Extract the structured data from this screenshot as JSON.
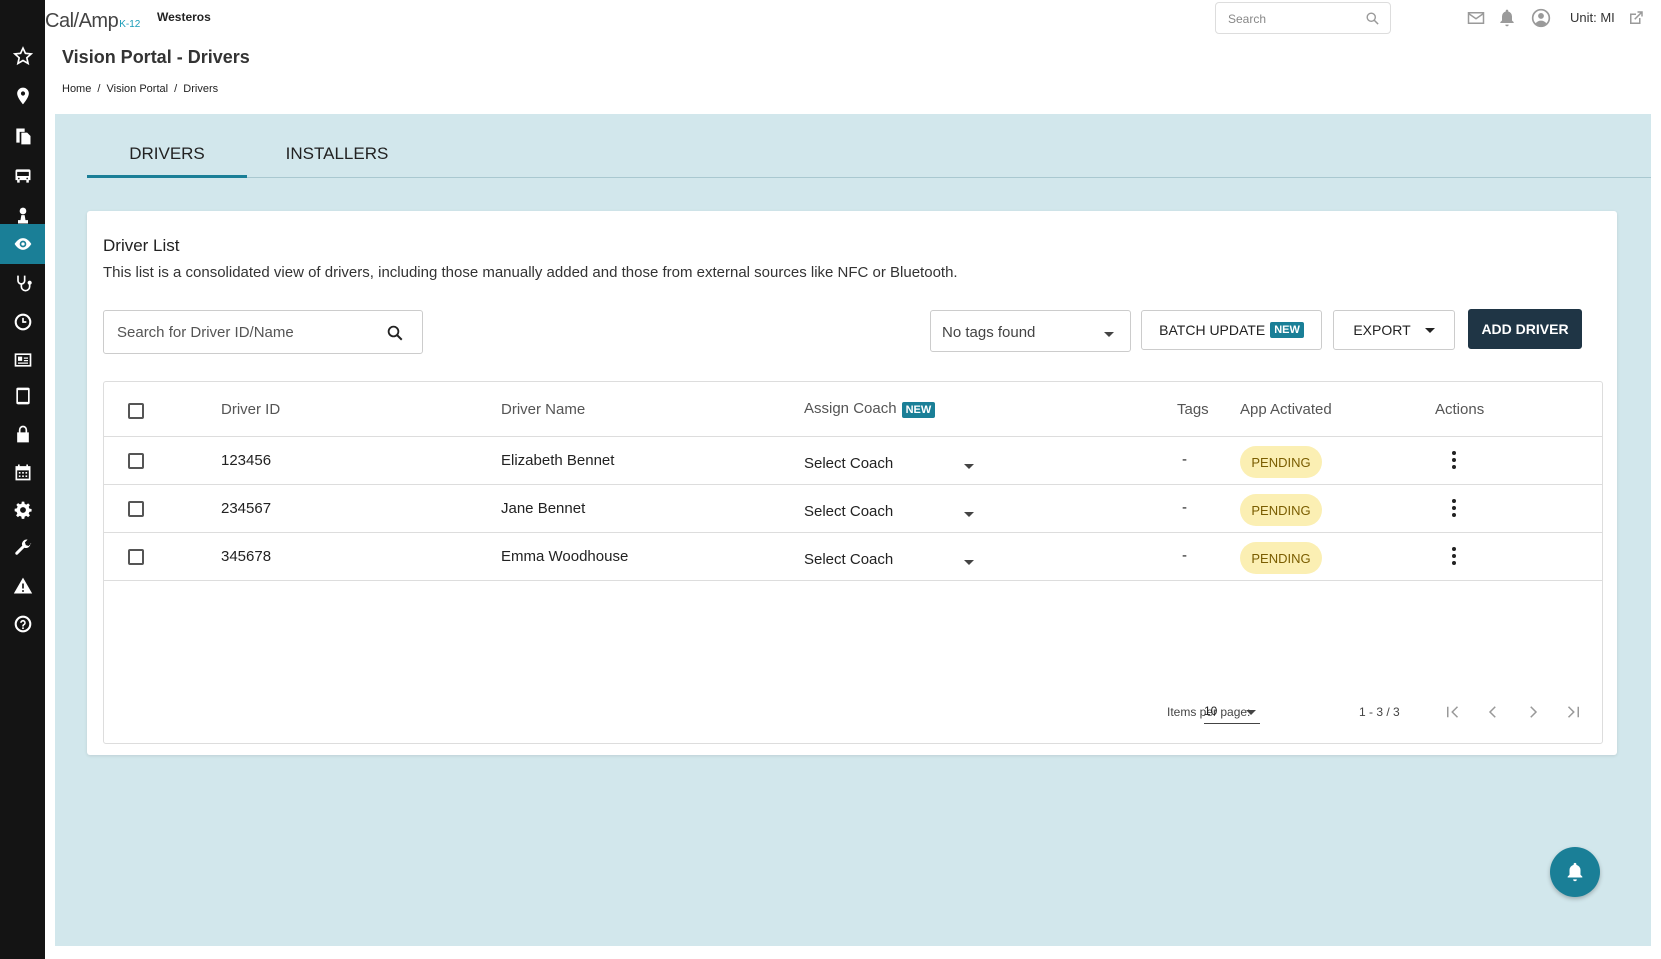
{
  "app": {
    "logo_main": "Cal/Amp",
    "logo_sub": "K-12",
    "org_name": "Westeros",
    "search_placeholder": "Search",
    "unit_label": "Unit: MI"
  },
  "sidebar": {
    "items": [
      {
        "icon": "star-icon"
      },
      {
        "icon": "map-pin-icon"
      },
      {
        "icon": "documents-icon"
      },
      {
        "icon": "bus-icon"
      },
      {
        "icon": "driver-icon"
      },
      {
        "icon": "eye-icon",
        "active": true
      },
      {
        "icon": "stethoscope-icon"
      },
      {
        "icon": "clock-icon"
      },
      {
        "icon": "id-card-icon"
      },
      {
        "icon": "tablet-icon"
      },
      {
        "icon": "lock-icon"
      },
      {
        "icon": "calendar-icon"
      },
      {
        "icon": "gear-icon"
      },
      {
        "icon": "wrench-icon"
      },
      {
        "icon": "warning-icon"
      },
      {
        "icon": "help-icon"
      }
    ]
  },
  "page": {
    "title": "Vision Portal - Drivers",
    "breadcrumb": [
      "Home",
      "/",
      "Vision Portal",
      "/",
      "Drivers"
    ]
  },
  "tabs": [
    {
      "label": "DRIVERS",
      "active": true
    },
    {
      "label": "INSTALLERS",
      "active": false
    }
  ],
  "driver_list": {
    "title": "Driver List",
    "description": "This list is a consolidated view of drivers, including those manually added and those from external sources like NFC or Bluetooth.",
    "search_placeholder": "Search for Driver ID/Name",
    "tags_value": "No tags found",
    "batch_update_label": "BATCH UPDATE",
    "new_badge": "NEW",
    "export_label": "EXPORT",
    "add_driver_label": "ADD DRIVER",
    "columns": {
      "driver_id": "Driver ID",
      "driver_name": "Driver Name",
      "assign_coach": "Assign Coach",
      "tags": "Tags",
      "app_activated": "App Activated",
      "actions": "Actions"
    },
    "rows": [
      {
        "id": "123456",
        "name": "Elizabeth Bennet",
        "coach": "Select Coach",
        "tags": "-",
        "status": "PENDING"
      },
      {
        "id": "234567",
        "name": "Jane Bennet",
        "coach": "Select Coach",
        "tags": "-",
        "status": "PENDING"
      },
      {
        "id": "345678",
        "name": "Emma Woodhouse",
        "coach": "Select Coach",
        "tags": "-",
        "status": "PENDING"
      }
    ],
    "pagination": {
      "items_per_page_label": "Items per page:",
      "items_per_page": "10",
      "range": "1 - 3 / 3"
    }
  },
  "colors": {
    "accent": "#1a7f97",
    "sidebar_bg": "#141414",
    "content_bg": "#d2e7ec",
    "primary_button": "#1f3545",
    "pending_badge": "#fbefb3"
  }
}
